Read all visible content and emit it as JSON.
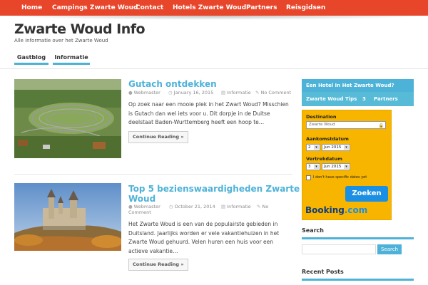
{
  "topnav": {
    "items": [
      "Home",
      "Campings Zwarte Woud",
      "Contact",
      "Hotels Zwarte Woud",
      "Partners",
      "Reisgidsen"
    ]
  },
  "site": {
    "title": "Zwarte Woud Info",
    "description": "Alle informatie over het Zwarte Woud"
  },
  "subnav": {
    "items": [
      "Gastblog",
      "Informatie"
    ]
  },
  "posts": [
    {
      "title": "Gutach ontdekken",
      "author": "Webmaster",
      "date": "January 16, 2015",
      "category": "Informatie",
      "comments": "No Comment",
      "excerpt": "Op zoek naar een mooie plek in het Zwart Woud? Misschien is Gutach dan wel iets voor u. Dit dorpje in de Duitse deelstaat Baden-Wurttemberg heeft een hoop te…",
      "readmore": "Continue Reading »"
    },
    {
      "title_line1": "Top 5 bezienswaardigheden Zwarte",
      "title_line2": "Woud",
      "author": "Webmaster",
      "date": "October 21, 2014",
      "category": "Informatie",
      "comments_line1": "No",
      "comments_line2": "Comment",
      "excerpt": "Het Zwarte Woud is een van de populairste gebieden in Duitsland. Jaarlijks worden er vele vakantiehuizen in het Zwarte Woud gehuurd. Velen huren een huis voor een actieve vakantie…",
      "readmore": "Continue Reading »"
    }
  ],
  "sidebar": {
    "hotel_header": "Een Hotel In Het Zwarte Woud?",
    "tabs": [
      "Zwarte Woud Tips",
      "3",
      "Partners"
    ],
    "booking": {
      "destination_label": "Destination",
      "destination_value": "Zwarte Woud",
      "checkin_label": "Aankomstdatum",
      "checkin_day": "2",
      "checkin_month": "Jun 2015",
      "checkout_label": "Vertrekdatum",
      "checkout_day": "3",
      "checkout_month": "Jun 2015",
      "nodates_label": "I don't have specific dates yet",
      "search_button": "Zoeken",
      "logo_main": "Booking",
      "logo_suffix": ".com"
    },
    "search_title": "Search",
    "search_button": "Search",
    "recent_posts_title": "Recent Posts"
  },
  "icons": {
    "author": "user-icon",
    "date": "clock-icon",
    "category": "folder-icon",
    "comments": "comment-icon",
    "lock": "lock-icon",
    "calendar": "calendar-icon"
  },
  "colors": {
    "nav_bg": "#e8462b",
    "accent": "#4db2d8",
    "booking_bg": "#f7b500",
    "booking_button": "#1a8fe3"
  }
}
